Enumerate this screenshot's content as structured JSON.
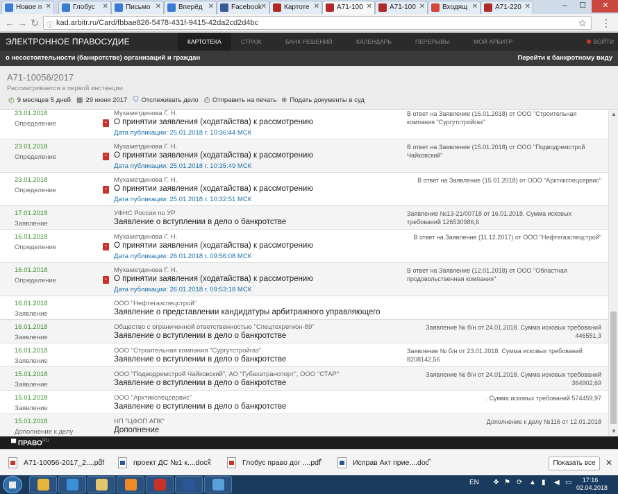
{
  "browser": {
    "tabs": [
      {
        "label": "Новое п",
        "icon_color": "#3a7bd5",
        "active": false
      },
      {
        "label": "Глобус",
        "icon_color": "#3a7bd5",
        "active": false
      },
      {
        "label": "Письмо",
        "icon_color": "#3a7bd5",
        "active": false
      },
      {
        "label": "Вперёд",
        "icon_color": "#3a7bd5",
        "active": false
      },
      {
        "label": "Facebook",
        "icon_color": "#3b5998",
        "active": false
      },
      {
        "label": "Картоте",
        "icon_color": "#b02a2a",
        "active": false
      },
      {
        "label": "А71-100",
        "icon_color": "#b02a2a",
        "active": true
      },
      {
        "label": "А71-100",
        "icon_color": "#b02a2a",
        "active": false
      },
      {
        "label": "Входящ",
        "icon_color": "#d44638",
        "active": false
      },
      {
        "label": "А71-220",
        "icon_color": "#b02a2a",
        "active": false
      }
    ],
    "url": "kad.arbitr.ru/Card/fbbae826-5478-431f-9415-42da2cd2d4bc"
  },
  "site": {
    "logo": "ЭЛЕКТРОННОЕ ПРАВОСУДИЕ",
    "nav": [
      "КАРТОТЕКА",
      "СТРАЖ",
      "БАНК РЕШЕНИЙ",
      "КАЛЕНДАРЬ",
      "ПЕРЕРЫВЫ",
      "МОЙ АРБИТР"
    ],
    "login": "ВОЙТИ",
    "subheader_left": "о несостоятельности (банкротстве) организаций и граждан",
    "subheader_right": "Перейти к банкротному виду"
  },
  "case": {
    "number": "А71-10056/2017",
    "status": "Рассматривается в первой инстанции",
    "duration": "9 месяцев 5 дней",
    "date": "29 июня 2017",
    "track": "Отслеживать дело",
    "print": "Отправить на печать",
    "submit": "Подать документы в суд"
  },
  "events": [
    {
      "date": "23.01.2018",
      "type": "Определение",
      "judge": "Мухаметдинова Г. Н.",
      "title": "О принятии заявления (ходатайства) к рассмотрению",
      "pub": "Дата публикации: 25.01.2018 г. 10:36:44 МСК",
      "note": "В ответ на Заявление (16.01.2018) от ООО \"Строительная компания \"Сургутстройгаз\"",
      "note_align": "left",
      "alt": false
    },
    {
      "date": "23.01.2018",
      "type": "Определение",
      "judge": "Мухаметдинова Г. Н.",
      "title": "О принятии заявления (ходатайства) к рассмотрению",
      "pub": "Дата публикации: 25.01.2018 г. 10:35:49 МСК",
      "note": "В ответ на Заявление (15.01.2018) от ООО \"Подводремстрой Чайковский\"",
      "note_align": "left",
      "alt": true
    },
    {
      "date": "23.01.2018",
      "type": "Определение",
      "judge": "Мухаметдинова Г. Н.",
      "title": "О принятии заявления (ходатайства) к рассмотрению",
      "pub": "Дата публикации: 25.01.2018 г. 10:32:51 МСК",
      "note": "В ответ на Заявление (15.01.2018) от ООО \"Арктикспецсервис\"",
      "note_align": "right",
      "alt": false
    },
    {
      "date": "17.01.2018",
      "type": "Заявление",
      "judge": "УФНС России по УР",
      "title": "Заявление о вступлении в дело о банкротстве",
      "pub": "",
      "note": "Заявление №13-21/00718 от 16.01.2018. Сумма исковых требований 126530986,6",
      "note_align": "left",
      "alt": true
    },
    {
      "date": "16.01.2018",
      "type": "Определение",
      "judge": "Мухаметдинова Г. Н.",
      "title": "О принятии заявления (ходатайства) к рассмотрению",
      "pub": "Дата публикации: 26.01.2018 г. 09:56:08 МСК",
      "note": "В ответ на Заявление (11.12.2017) от ООО \"Нефтегазспецстрой\"",
      "note_align": "right",
      "alt": false
    },
    {
      "date": "16.01.2018",
      "type": "Определение",
      "judge": "Мухаметдинова Г. Н.",
      "title": "О принятии заявления (ходатайства) к рассмотрению",
      "pub": "Дата публикации: 26.01.2018 г. 09:53:18 МСК",
      "note": "В ответ на Заявление (12.01.2018) от ООО \"Областная продовольственная компания\"",
      "note_align": "left",
      "alt": true
    },
    {
      "date": "16.01.2018",
      "type": "Заявление",
      "judge": "ООО \"Нефтегазспецстрой\"",
      "title": "Заявление о представлении кандидатуры арбитражного управляющего",
      "pub": "",
      "note": "",
      "note_align": "left",
      "alt": false
    },
    {
      "date": "16.01.2018",
      "type": "Заявление",
      "judge": "Общество с ограниченной ответственностью \"Спецтехрегион-89\"",
      "title": "Заявление о вступлении в дело о банкротстве",
      "pub": "",
      "note": "Заявление № б/н от 24.01.2018. Сумма исковых требований 446551,3",
      "note_align": "right",
      "alt": true
    },
    {
      "date": "16.01.2018",
      "type": "Заявление",
      "judge": "ООО \"Строительная компания \"Сургутстройгаз\"",
      "title": "Заявление о вступлении в дело о банкротстве",
      "pub": "",
      "note": "Заявление № б/н от 23.01.2018. Сумма исковых требований 8208142,56",
      "note_align": "left",
      "alt": false
    },
    {
      "date": "15.01.2018",
      "type": "Заявление",
      "judge": "ООО \"Подводремстрой Чайковский\", АО \"Губахатранспорт\", ООО \"СТАР\"",
      "title": "Заявление о вступлении в дело о банкротстве",
      "pub": "",
      "note": "Заявление № б/н от 24.01.2018. Сумма исковых требований 364902,69",
      "note_align": "right",
      "alt": true
    },
    {
      "date": "15.01.2018",
      "type": "Заявление",
      "judge": "ООО \"Арктикспецсервис\"",
      "title": "Заявление о вступлении в дело о банкротстве",
      "pub": "",
      "note": ". Сумма исковых требований 574459,97",
      "note_align": "right",
      "alt": false
    },
    {
      "date": "15.01.2018",
      "type": "Дополнение к делу",
      "judge": "НП \"ЦФОП АПК\"",
      "title": "Дополнение",
      "pub": "",
      "note": "Дополнение к делу №116 от 12.01.2018",
      "note_align": "right",
      "alt": true
    }
  ],
  "pravo": {
    "brand": "ПРАВО",
    "suffix": "RU"
  },
  "downloads": [
    {
      "name": "А71-10056-2017_2....pdf",
      "kind": "pdf"
    },
    {
      "name": "проект ДС №1 к....docx",
      "kind": "doc"
    },
    {
      "name": "Глобус право дог ....pdf",
      "kind": "pdf"
    },
    {
      "name": "Исправ Акт прие....doc",
      "kind": "doc"
    }
  ],
  "downloads_show_all": "Показать все",
  "taskbar": {
    "lang": "EN",
    "time": "17:16",
    "date": "02.04.2018",
    "apps": [
      {
        "name": "chrome",
        "color": "#e9b43a"
      },
      {
        "name": "internet-explorer",
        "color": "#3b8fd6"
      },
      {
        "name": "file-explorer",
        "color": "#e3c66b"
      },
      {
        "name": "media-player",
        "color": "#f08a24"
      },
      {
        "name": "acrobat-reader",
        "color": "#c8322b"
      },
      {
        "name": "word",
        "color": "#2b5797"
      },
      {
        "name": "remote-desktop",
        "color": "#5aa0d8"
      }
    ]
  }
}
